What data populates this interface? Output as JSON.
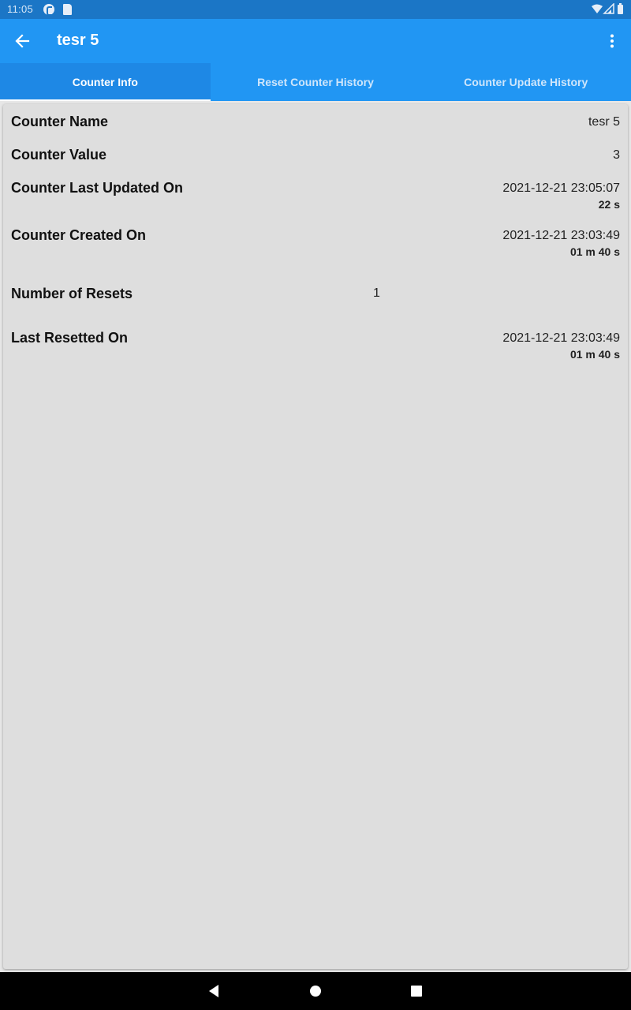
{
  "status_bar": {
    "time": "11:05",
    "icons": [
      "app-icon",
      "sd-card-icon",
      "wifi-icon",
      "signal-icon",
      "battery-icon"
    ]
  },
  "app_bar": {
    "title": "tesr 5",
    "back_icon": "arrow-back-icon",
    "menu_icon": "more-vert-icon"
  },
  "tabs": [
    {
      "label": "Counter Info",
      "active": true
    },
    {
      "label": "Reset Counter History",
      "active": false
    },
    {
      "label": "Counter Update History",
      "active": false
    }
  ],
  "info": {
    "counter_name": {
      "label": "Counter Name",
      "value": "tesr 5"
    },
    "counter_value": {
      "label": "Counter Value",
      "value": "3"
    },
    "last_updated": {
      "label": "Counter Last Updated On",
      "value": "2021-12-21 23:05:07",
      "ago": "22 s"
    },
    "created": {
      "label": "Counter Created On",
      "value": "2021-12-21 23:03:49",
      "ago": "01 m 40 s"
    },
    "resets": {
      "label": "Number of Resets",
      "value": "1"
    },
    "last_reset": {
      "label": "Last Resetted On",
      "value": "2021-12-21 23:03:49",
      "ago": "01 m 40 s"
    }
  },
  "nav_bar": {
    "icons": [
      "nav-back-icon",
      "nav-home-icon",
      "nav-recents-icon"
    ]
  },
  "colors": {
    "primary": "#2196f3",
    "status_bar": "#1b76c6",
    "active_tab": "#1e88e5",
    "card": "#dedede"
  }
}
